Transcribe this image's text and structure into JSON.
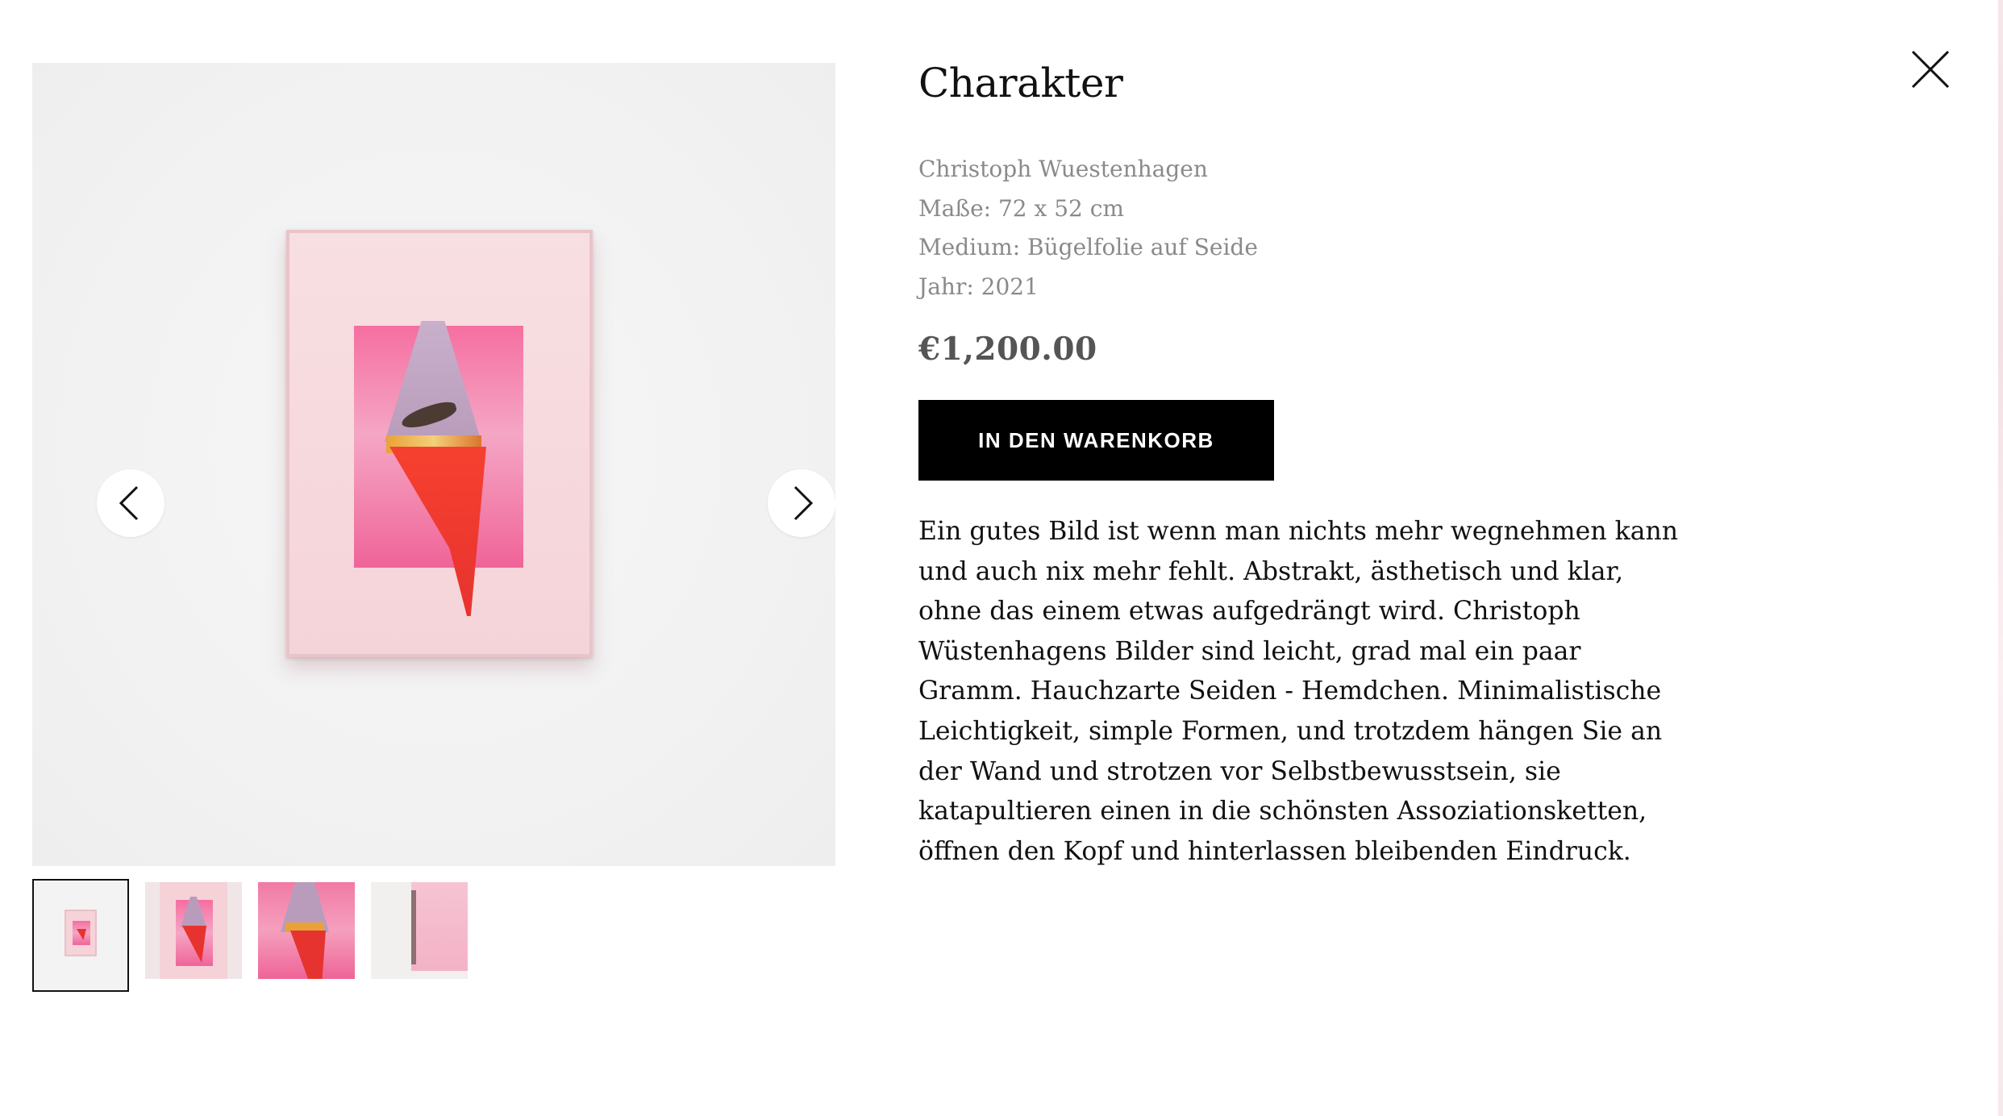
{
  "product": {
    "title": "Charakter",
    "artist": "Christoph Wuestenhagen",
    "dimensions": "Maße: 72 x 52 cm",
    "medium": "Medium: Bügelfolie auf Seide",
    "year": "Jahr: 2021",
    "price": "€1,200.00",
    "add_to_cart_label": "IN DEN WARENKORB",
    "description_lines": [
      "Ein gutes Bild ist wenn man nichts mehr wegnehmen kann",
      "und auch nix mehr fehlt. Abstrakt, ästhetisch und klar,",
      "ohne das einem etwas aufgedrängt wird. Christoph",
      "Wüstenhagens Bilder sind leicht, grad mal ein paar",
      "Gramm. Hauchzarte Seiden - Hemdchen. Minimalistische",
      "Leichtigkeit, simple Formen, und trotzdem hängen Sie an",
      "der Wand und strotzen vor Selbstbewusstsein, sie",
      "katapultieren einen in die schönsten Assoziationsketten,",
      "öffnen den Kopf und hinterlassen bleibenden Eindruck."
    ]
  },
  "gallery": {
    "thumbnail_count": 4,
    "active_index": 0,
    "icons": {
      "prev": "chevron-left-icon",
      "next": "chevron-right-icon",
      "close": "close-icon"
    }
  },
  "colors": {
    "button_bg": "#000000",
    "button_text": "#ffffff",
    "meta_text": "#8a8a8a",
    "price_text": "#555555",
    "artwork_pink": "#f56fa0",
    "artwork_red": "#e7332f"
  }
}
